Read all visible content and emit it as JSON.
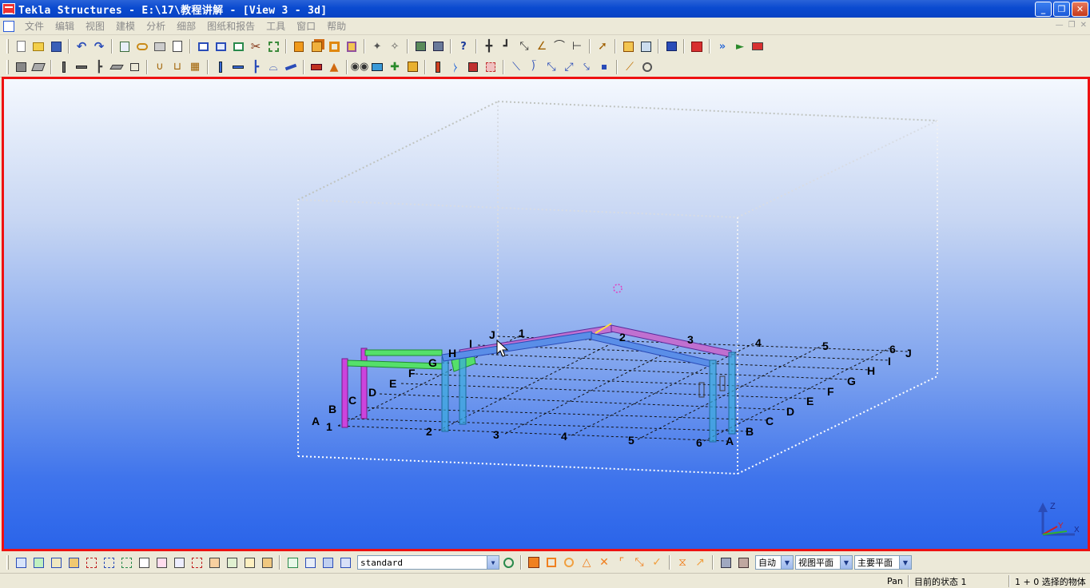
{
  "window": {
    "title": "Tekla Structures - E:\\17\\教程讲解 - [View 3 - 3d]",
    "minimize": "_",
    "restore": "❐",
    "close": "✕"
  },
  "menu": [
    "文件",
    "编辑",
    "视图",
    "建模",
    "分析",
    "细部",
    "图纸和报告",
    "工具",
    "窗口",
    "帮助"
  ],
  "viewport": {
    "axis_labels": {
      "z": "Z",
      "y": "Y",
      "x": "X"
    },
    "grid_labels_near_numbers": [
      "1",
      "2",
      "3",
      "4",
      "5",
      "6"
    ],
    "grid_labels_near_letters": [
      "A",
      "B",
      "C",
      "D",
      "E",
      "F",
      "G",
      "H",
      "I",
      "J"
    ],
    "grid_labels_far_numbers": [
      "1",
      "2",
      "3",
      "4",
      "5",
      "6"
    ],
    "grid_labels_far_letters": [
      "J",
      "I",
      "H",
      "G",
      "F",
      "E",
      "D",
      "C",
      "B",
      "A"
    ]
  },
  "bottom": {
    "filter_value": "standard",
    "mode_auto": "自动",
    "view_plane": "视图平面",
    "main_plane": "主要平面"
  },
  "status": {
    "command": "Pan",
    "current_state": "目前的状态 1",
    "selection": "1 + 0 选择的物体"
  },
  "colors": {
    "viewport_border": "#ee1111",
    "title_bar": "#0a4ad0",
    "beam_magenta": "#cc44dd",
    "beam_green": "#44dd44",
    "beam_cyan": "#33aadd"
  }
}
